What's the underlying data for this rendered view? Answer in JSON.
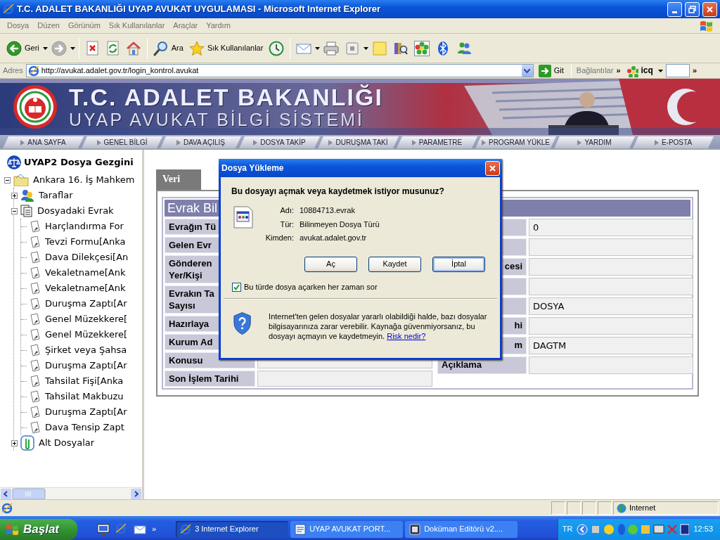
{
  "window": {
    "title": "T.C. ADALET BAKANLIĞI UYAP AVUKAT UYGULAMASI - Microsoft Internet Explorer"
  },
  "menu": [
    "Dosya",
    "Düzen",
    "Görünüm",
    "Sık Kullanılanlar",
    "Araçlar",
    "Yardım"
  ],
  "toolbar": [
    {
      "kind": "back",
      "label": "Geri",
      "dropdown": true
    },
    {
      "kind": "forward",
      "dropdown": true
    },
    {
      "kind": "stop"
    },
    {
      "kind": "refresh"
    },
    {
      "kind": "home"
    },
    {
      "kind": "search",
      "label": "Ara"
    },
    {
      "kind": "favorites",
      "label": "Sık Kullanılanlar"
    },
    {
      "kind": "history"
    },
    {
      "kind": "mail",
      "dropdown": true
    },
    {
      "kind": "print"
    },
    {
      "kind": "media",
      "dropdown": true
    },
    {
      "kind": "note"
    },
    {
      "kind": "research"
    },
    {
      "kind": "icq"
    },
    {
      "kind": "bluetooth"
    },
    {
      "kind": "messenger"
    }
  ],
  "address": {
    "label": "Adres",
    "url": "http://avukat.adalet.gov.tr/login_kontrol.avukat",
    "go": "Git",
    "links": "Bağlantılar",
    "links_more": "»",
    "icq": "icq",
    "more": "»"
  },
  "banner": {
    "title": "T.C. ADALET BAKANLIĞI",
    "subtitle": "UYAP AVUKAT BİLGİ SİSTEMİ"
  },
  "nav": [
    "ANA SAYFA",
    "GENEL BİLGİ",
    "DAVA AÇILIŞ",
    "DOSYA TAKİP",
    "DURUŞMA TAKİ",
    "PARAMETRE",
    "PROGRAM YÜKLE",
    "YARDIM",
    "E-POSTA"
  ],
  "tree": {
    "title": "UYAP2 Dosya Gezgini",
    "nodes": [
      {
        "label": "Ankara 16. İş Mahkem",
        "kind": "folder",
        "expanded": true,
        "children": [
          {
            "label": "Taraflar",
            "kind": "parties",
            "expanded": false
          },
          {
            "label": "Dosyadaki Evrak",
            "kind": "documents",
            "expanded": true,
            "children": [
              {
                "label": "Harçlandırma For",
                "kind": "document"
              },
              {
                "label": "Tevzi Formu[Anka",
                "kind": "document"
              },
              {
                "label": "Dava Dilekçesi[An",
                "kind": "document"
              },
              {
                "label": "Vekaletname[Ank",
                "kind": "document"
              },
              {
                "label": "Vekaletname[Ank",
                "kind": "document"
              },
              {
                "label": "Duruşma Zaptı[Ar",
                "kind": "document"
              },
              {
                "label": "Genel Müzekkere[",
                "kind": "document"
              },
              {
                "label": "Genel Müzekkere[",
                "kind": "document"
              },
              {
                "label": "Şirket veya Şahsa",
                "kind": "document"
              },
              {
                "label": "Duruşma Zaptı[Ar",
                "kind": "document"
              },
              {
                "label": "Tahsilat Fişi[Anka",
                "kind": "document"
              },
              {
                "label": "Tahsilat Makbuzu",
                "kind": "document"
              },
              {
                "label": "Duruşma Zaptı[Ar",
                "kind": "document"
              },
              {
                "label": "Dava Tensip Zapt",
                "kind": "document"
              }
            ]
          },
          {
            "label": "Alt Dosyalar",
            "kind": "attachments",
            "expanded": false
          }
        ]
      }
    ]
  },
  "tabs": [
    {
      "label": "Veri",
      "selected": true
    }
  ],
  "form": {
    "title": "Evrak Bil",
    "left": [
      {
        "label": "Evrağın Tü"
      },
      {
        "label": "Gelen Evr"
      },
      {
        "label": "Gönderen\nYer/Kişi"
      },
      {
        "label": "Evrakın Ta\nSayısı"
      },
      {
        "label": "Hazırlaya"
      },
      {
        "label": "Kurum Ad"
      },
      {
        "label": "Konusu",
        "field": true
      },
      {
        "label": "Son İşlem Tarihi",
        "field": true
      }
    ],
    "right": [
      {
        "value": "0"
      },
      {
        "field": true
      },
      {
        "label": "cesi",
        "clipped": true,
        "field": true
      },
      {
        "field": true
      },
      {
        "value": "DOSYA"
      },
      {
        "label": "hi",
        "clipped": true,
        "field": true
      },
      {
        "label": "m",
        "clipped": true,
        "value": "DAGTM"
      },
      {
        "label": "Açıklama",
        "field": true
      }
    ]
  },
  "dialog": {
    "title": "Dosya Yükleme",
    "question": "Bu dosyayı açmak veya kaydetmek istiyor musunuz?",
    "fields": [
      {
        "label": "Adı:",
        "value": "10884713.evrak"
      },
      {
        "label": "Tür:",
        "value": "Bilinmeyen Dosya Türü"
      },
      {
        "label": "Kimden:",
        "value": "avukat.adalet.gov.tr"
      }
    ],
    "buttons": [
      {
        "label": "Aç",
        "focused": false
      },
      {
        "label": "Kaydet",
        "focused": false
      },
      {
        "label": "İptal",
        "focused": true
      }
    ],
    "always_ask": {
      "label": "Bu türde dosya açarken her zaman sor",
      "checked": true
    },
    "warning": "Internet'ten gelen dosyalar yararlı olabildiği halde, bazı dosyalar bilgisayarınıza zarar verebilir. Kaynağa güvenmiyorsanız, bu dosyayı açmayın ve kaydetmeyin.",
    "link": "Risk nedir?"
  },
  "status_bar": {
    "zone": "Internet"
  },
  "taskbar": {
    "start": "Başlat",
    "more": "»",
    "windows": [
      {
        "kind": "ie",
        "label": "3 Internet Explorer",
        "selected": true
      },
      {
        "kind": "word",
        "label": "UYAP AVUKAT PORT...",
        "selected": false
      },
      {
        "kind": "app",
        "label": "Doküman Editörü v2....",
        "selected": false
      }
    ],
    "language": "TR",
    "clock": "12:53"
  }
}
